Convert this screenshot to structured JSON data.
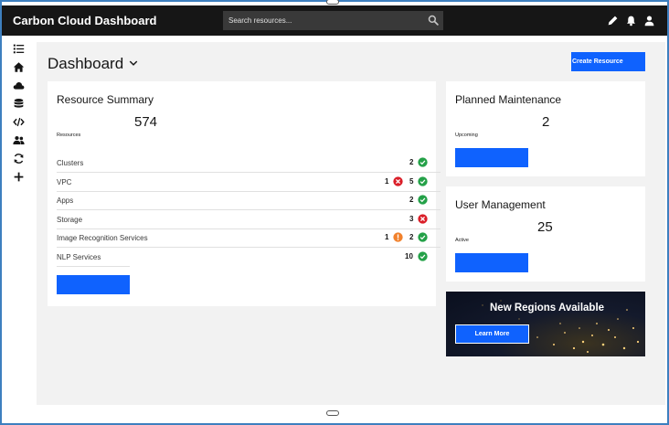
{
  "app": {
    "title": "Carbon Cloud Dashboard"
  },
  "search": {
    "placeholder": "Search resources..."
  },
  "header_icons": [
    "edit-icon",
    "notification-icon",
    "user-icon"
  ],
  "sidebar": {
    "icons": [
      "list-icon",
      "home-icon",
      "cloud-icon",
      "database-icon",
      "code-icon",
      "users-icon",
      "refresh-icon",
      "add-icon"
    ]
  },
  "page": {
    "title": "Dashboard",
    "create_label": "Create Resource"
  },
  "summary": {
    "title": "Resource Summary",
    "total": "574",
    "total_label": "Resources",
    "rows": [
      {
        "name": "Clusters",
        "ok": "2"
      },
      {
        "name": "VPC",
        "err": "1",
        "ok": "5"
      },
      {
        "name": "Apps",
        "ok": "2"
      },
      {
        "name": "Storage",
        "err": "3"
      },
      {
        "name": "Image Recognition Services",
        "warn": "1",
        "ok": "2"
      },
      {
        "name": "NLP Services",
        "ok": "10"
      }
    ]
  },
  "maintenance": {
    "title": "Planned Maintenance",
    "count": "2",
    "label": "Upcoming"
  },
  "users": {
    "title": "User Management",
    "count": "25",
    "label": "Active"
  },
  "promo": {
    "title": "New Regions Available",
    "button": "Learn More"
  },
  "colors": {
    "primary": "#0f62fe",
    "success": "#24a148",
    "error": "#da1e28",
    "warning": "#f1812c",
    "header": "#161616"
  }
}
